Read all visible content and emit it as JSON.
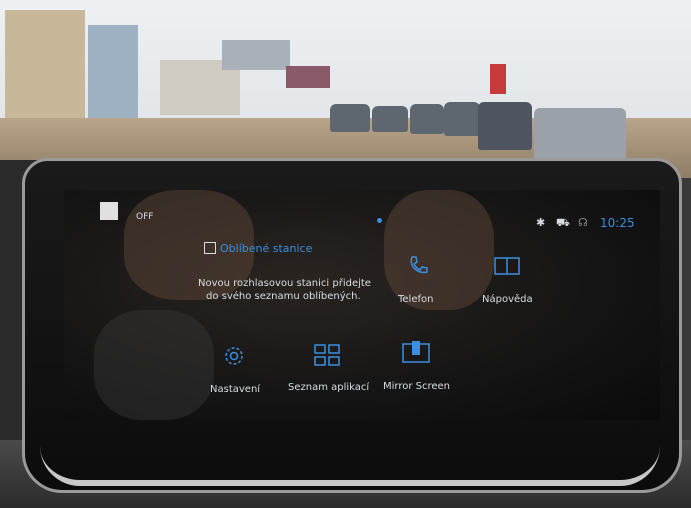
{
  "status_bar": {
    "power_state": "OFF",
    "time": "10:25"
  },
  "favorites_widget": {
    "title": "Oblíbené stanice",
    "message_line1": "Novou rozhlasovou stanici přidejte",
    "message_line2": "do svého seznamu oblíbených."
  },
  "apps": [
    {
      "label": "Telefon",
      "icon": "phone-icon"
    },
    {
      "label": "Nápověda",
      "icon": "help-book-icon"
    },
    {
      "label": "Nastavení",
      "icon": "settings-gear-icon"
    },
    {
      "label": "Seznam aplikací",
      "icon": "app-grid-icon"
    },
    {
      "label": "Mirror Screen",
      "icon": "mirror-screen-icon"
    }
  ],
  "colors": {
    "accent": "#3a8fe0",
    "text": "#d8dde2"
  }
}
